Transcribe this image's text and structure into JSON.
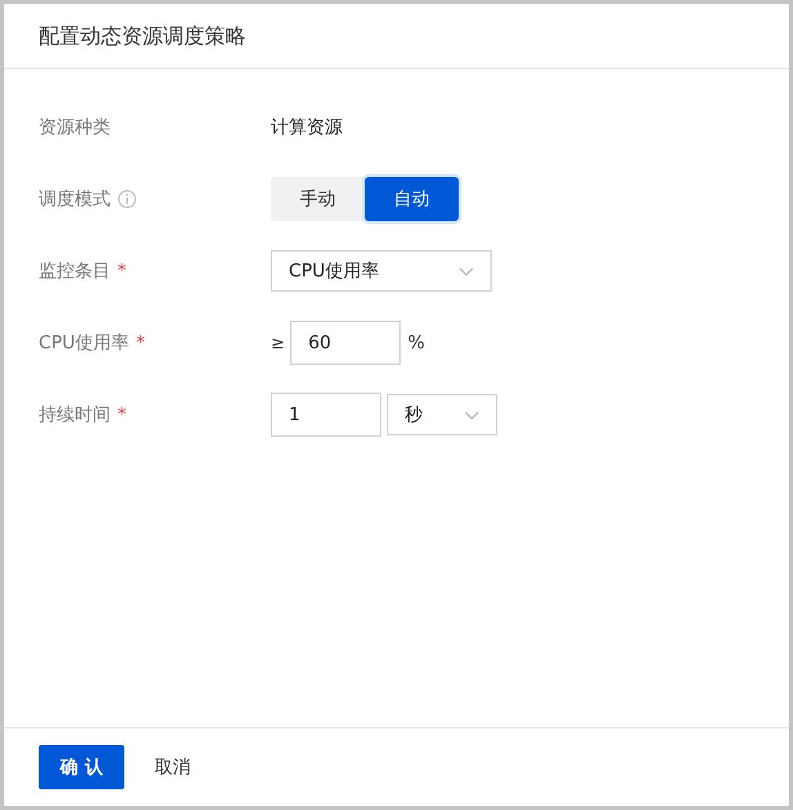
{
  "dialog": {
    "title": "配置动态资源调度策略"
  },
  "fields": [
    {
      "kind": "text",
      "label": "资源种类",
      "info": false,
      "value": "计算资源"
    },
    {
      "kind": "segmented",
      "label": "调度模式",
      "info": true,
      "options": [
        {
          "label": "手动",
          "selected": false
        },
        {
          "label": "自动",
          "selected": true
        }
      ]
    },
    {
      "kind": "select",
      "label": "监控条目",
      "info": false,
      "required_mark": "*",
      "value": "CPU使用率"
    },
    {
      "kind": "threshold",
      "label": "CPU使用率",
      "info": false,
      "required_mark": "*",
      "prefix": "≥",
      "value": "60",
      "suffix": "%"
    },
    {
      "kind": "duration",
      "label": "持续时间",
      "info": false,
      "required_mark": "*",
      "value": "1",
      "unit": "秒"
    }
  ],
  "footer": {
    "confirm": "确 认",
    "cancel": "取消"
  }
}
